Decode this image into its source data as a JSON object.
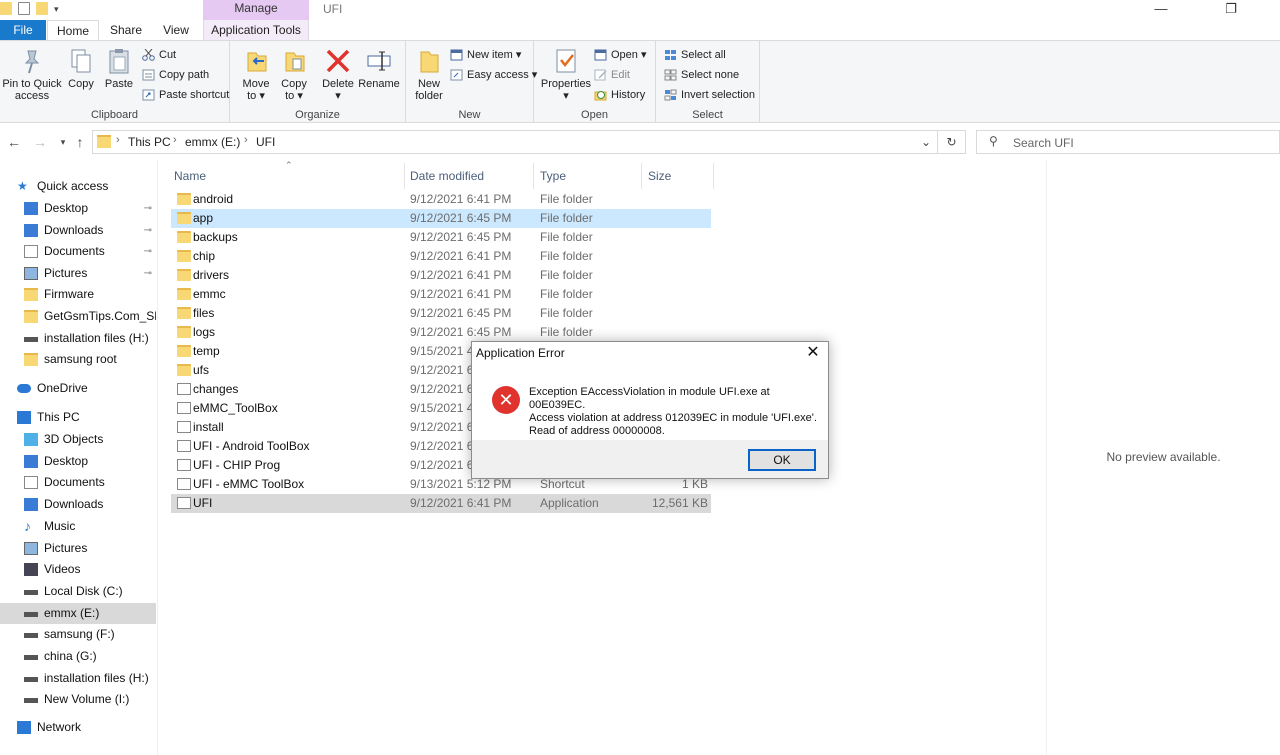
{
  "window": {
    "title": "UFI",
    "context_tab": "Manage",
    "controls": {
      "minimize": "—",
      "maximize": "❐"
    }
  },
  "ribbon_tabs": [
    "File",
    "Home",
    "Share",
    "View",
    "Application Tools"
  ],
  "ribbon": {
    "clipboard": {
      "label": "Clipboard",
      "pin": "Pin to Quick",
      "pin2": "access",
      "copy": "Copy",
      "paste": "Paste",
      "cut": "Cut",
      "copy_path": "Copy path",
      "paste_shortcut": "Paste shortcut"
    },
    "organize": {
      "label": "Organize",
      "move_to": "Move",
      "move_to2": "to ▾",
      "copy_to": "Copy",
      "copy_to2": "to ▾",
      "delete": "Delete",
      "delete2": "▾",
      "rename": "Rename"
    },
    "new": {
      "label": "New",
      "new_folder": "New",
      "new_folder2": "folder",
      "new_item": "New item ▾",
      "easy_access": "Easy access ▾"
    },
    "open": {
      "label": "Open",
      "properties": "Properties",
      "properties2": "▾",
      "open": "Open ▾",
      "edit": "Edit",
      "history": "History"
    },
    "select": {
      "label": "Select",
      "select_all": "Select all",
      "select_none": "Select none",
      "invert": "Invert selection"
    }
  },
  "address": {
    "crumbs": [
      "This PC",
      "emmx  (E:)",
      "UFI"
    ],
    "search_placeholder": "Search UFI"
  },
  "nav": {
    "quick_access": "Quick access",
    "quick_items": [
      "Desktop",
      "Downloads",
      "Documents",
      "Pictures",
      "Firmware",
      "GetGsmTips.Com_SM-J",
      "installation files (H:)",
      "samsung root"
    ],
    "onedrive": "OneDrive",
    "this_pc": "This PC",
    "pc_items": [
      "3D Objects",
      "Desktop",
      "Documents",
      "Downloads",
      "Music",
      "Pictures",
      "Videos",
      "Local Disk (C:)",
      "emmx  (E:)",
      "samsung (F:)",
      "china (G:)",
      "installation files (H:)",
      "New Volume (I:)"
    ],
    "network": "Network",
    "pin_glyph": "📌"
  },
  "columns": {
    "name": "Name",
    "date": "Date modified",
    "type": "Type",
    "size": "Size"
  },
  "files": [
    {
      "name": "android",
      "date": "9/12/2021 6:41 PM",
      "type": "File folder",
      "size": "",
      "kind": "folder"
    },
    {
      "name": "app",
      "date": "9/12/2021 6:45 PM",
      "type": "File folder",
      "size": "",
      "kind": "folder"
    },
    {
      "name": "backups",
      "date": "9/12/2021 6:45 PM",
      "type": "File folder",
      "size": "",
      "kind": "folder"
    },
    {
      "name": "chip",
      "date": "9/12/2021 6:41 PM",
      "type": "File folder",
      "size": "",
      "kind": "folder"
    },
    {
      "name": "drivers",
      "date": "9/12/2021 6:41 PM",
      "type": "File folder",
      "size": "",
      "kind": "folder"
    },
    {
      "name": "emmc",
      "date": "9/12/2021 6:41 PM",
      "type": "File folder",
      "size": "",
      "kind": "folder"
    },
    {
      "name": "files",
      "date": "9/12/2021 6:45 PM",
      "type": "File folder",
      "size": "",
      "kind": "folder"
    },
    {
      "name": "logs",
      "date": "9/12/2021 6:45 PM",
      "type": "File folder",
      "size": "",
      "kind": "folder"
    },
    {
      "name": "temp",
      "date": "9/15/2021 4:1",
      "type": "",
      "size": "",
      "kind": "folder"
    },
    {
      "name": "ufs",
      "date": "9/12/2021 6:4",
      "type": "",
      "size": "",
      "kind": "folder"
    },
    {
      "name": "changes",
      "date": "9/12/2021 6:4",
      "type": "",
      "size": "",
      "kind": "doc"
    },
    {
      "name": "eMMC_ToolBox",
      "date": "9/15/2021 4:2",
      "type": "",
      "size": "",
      "kind": "doc"
    },
    {
      "name": "install",
      "date": "9/12/2021 6:4",
      "type": "",
      "size": "",
      "kind": "doc"
    },
    {
      "name": "UFI - Android ToolBox",
      "date": "9/12/2021 6:4",
      "type": "",
      "size": "",
      "kind": "shortcut"
    },
    {
      "name": "UFI - CHIP Prog",
      "date": "9/12/2021 6:4",
      "type": "",
      "size": "",
      "kind": "shortcut"
    },
    {
      "name": "UFI - eMMC ToolBox",
      "date": "9/13/2021 5:12 PM",
      "type": "Shortcut",
      "size": "1 KB",
      "kind": "shortcut"
    },
    {
      "name": "UFI",
      "date": "9/12/2021 6:41 PM",
      "type": "Application",
      "size": "12,561 KB",
      "kind": "app"
    }
  ],
  "preview": {
    "text": "No preview available."
  },
  "dialog": {
    "title": "Application Error",
    "line1": "Exception EAccessViolation in module UFI.exe at 00E039EC.",
    "line2": "Access violation at address 012039EC in module 'UFI.exe'.",
    "line3": "Read of address 00000008.",
    "ok": "OK",
    "close": "✕"
  },
  "colors": {
    "file_tab": "#1979ca",
    "context": "#e6c9f2",
    "selected_row": "#cce8ff",
    "selected_app_row": "#d9d9d9",
    "error_red": "#e0332d"
  }
}
